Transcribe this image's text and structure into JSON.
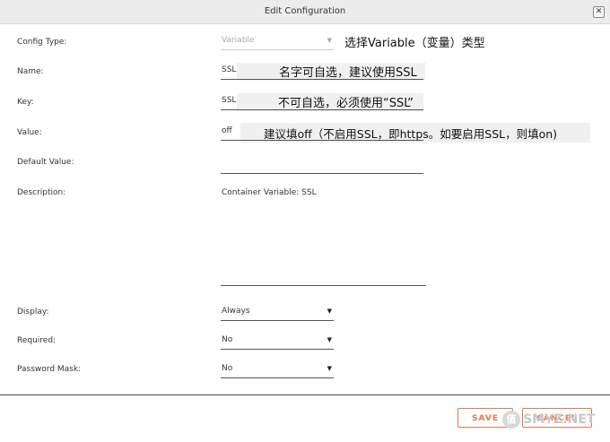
{
  "dialog": {
    "title": "Edit Configuration",
    "close_glyph": "✕"
  },
  "fields": {
    "config_type": {
      "label": "Config Type:",
      "value": "Variable"
    },
    "name": {
      "label": "Name:",
      "value": "SSL"
    },
    "key": {
      "label": "Key:",
      "value": "SSL"
    },
    "value": {
      "label": "Value:",
      "value": "off"
    },
    "default_value": {
      "label": "Default Value:",
      "value": ""
    },
    "description": {
      "label": "Description:",
      "value": "Container Variable: SSL"
    },
    "display": {
      "label": "Display:",
      "value": "Always"
    },
    "required": {
      "label": "Required:",
      "value": "No"
    },
    "password_mask": {
      "label": "Password Mask:",
      "value": "No"
    }
  },
  "notes": {
    "config_type": "选择Variable（变量）类型",
    "name": "名字可自选，建议使用SSL",
    "key": "不可自选，必须使用“SSL”",
    "value": "建议填off（不启用SSL，即https。如要启用SSL，则填on)"
  },
  "buttons": {
    "save": "SAVE",
    "cancel": "CANCEL"
  },
  "watermark": {
    "glyph": "值",
    "text": "SMYZ.NET"
  },
  "icons": {
    "dropdown": "caret-down-icon"
  },
  "colors": {
    "accent": "#e07a4a",
    "titlebar": "#ececec"
  }
}
